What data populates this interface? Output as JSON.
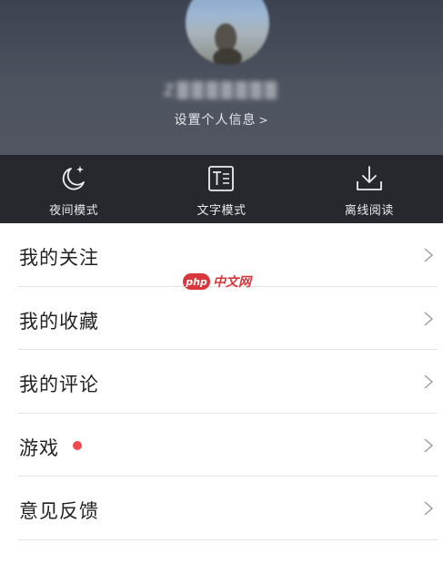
{
  "profile": {
    "username": "Z▒▒▒▒▒▒▒",
    "settings_link": "设置个人信息",
    "settings_chevron": ">",
    "avatar_icon": "avatar-photo"
  },
  "modes": [
    {
      "label": "夜间模式",
      "icon": "moon-sparkle-icon"
    },
    {
      "label": "文字模式",
      "icon": "text-mode-icon"
    },
    {
      "label": "离线阅读",
      "icon": "download-icon"
    }
  ],
  "menu": [
    {
      "label": "我的关注",
      "badge": false
    },
    {
      "label": "我的收藏",
      "badge": false
    },
    {
      "label": "我的评论",
      "badge": false
    },
    {
      "label": "游戏",
      "badge": true
    },
    {
      "label": "意见反馈",
      "badge": false
    }
  ],
  "watermark": {
    "logo": "php",
    "text": "中文网"
  },
  "colors": {
    "header_bg": "#4d5460",
    "modebar_bg": "#26282d",
    "badge": "#ef4a4f",
    "divider": "#e3e3e3",
    "watermark": "#d8363a"
  }
}
